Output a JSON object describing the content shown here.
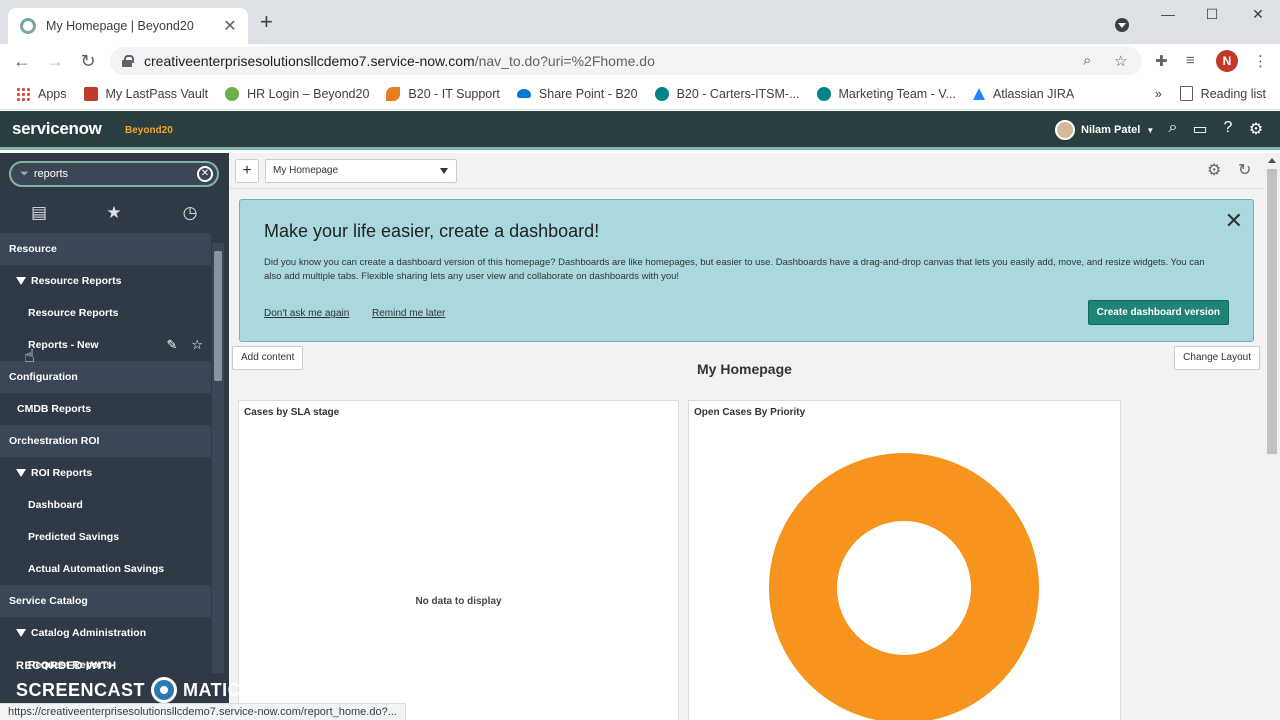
{
  "browser": {
    "tab_title": "My Homepage | Beyond20",
    "url_host": "creativeenterprisesolutionsllcdemo7.service-now.com",
    "url_path": "/nav_to.do?uri=%2Fhome.do",
    "profile_initial": "N",
    "bookmarks": [
      {
        "label": "Apps",
        "color": "#e8453c"
      },
      {
        "label": "My LastPass Vault",
        "color": "#c0392b"
      },
      {
        "label": "HR Login – Beyond20",
        "color": "#6ab04c"
      },
      {
        "label": "B20 - IT Support",
        "color": "#e67e22"
      },
      {
        "label": "Share Point - B20",
        "color": "#0078d4"
      },
      {
        "label": "B20 - Carters-ITSM-...",
        "color": "#038387"
      },
      {
        "label": "Marketing Team - V...",
        "color": "#038387"
      },
      {
        "label": "Atlassian JIRA",
        "color": "#2684ff"
      }
    ],
    "reading_list": "Reading list",
    "more": "»"
  },
  "header": {
    "logo": "servicenow",
    "instance": "Beyond20",
    "user_name": "Nilam Patel"
  },
  "navigator": {
    "filter_value": "reports",
    "items": [
      {
        "type": "app",
        "label": "Resource"
      },
      {
        "type": "sec",
        "label": "Resource Reports"
      },
      {
        "type": "mod",
        "label": "Resource Reports"
      },
      {
        "type": "mod",
        "label": "Reports - New"
      },
      {
        "type": "app",
        "label": "Configuration"
      },
      {
        "type": "mod2",
        "label": "CMDB Reports"
      },
      {
        "type": "app",
        "label": "Orchestration ROI"
      },
      {
        "type": "sec",
        "label": "ROI Reports"
      },
      {
        "type": "mod",
        "label": "Dashboard"
      },
      {
        "type": "mod",
        "label": "Predicted Savings"
      },
      {
        "type": "mod",
        "label": "Actual Automation Savings"
      },
      {
        "type": "app",
        "label": "Service Catalog"
      },
      {
        "type": "sec",
        "label": "Catalog Administration"
      },
      {
        "type": "mod",
        "label": "Request Reports"
      }
    ]
  },
  "content": {
    "homepage_select": "My Homepage",
    "banner": {
      "title": "Make your life easier, create a dashboard!",
      "text": "Did you know you can create a dashboard version of this homepage? Dashboards are like homepages, but easier to use. Dashboards have a drag-and-drop canvas that lets you easily add, move, and resize widgets. You can also add multiple tabs. Flexible sharing lets any user view and collaborate on dashboards with you!",
      "dont_ask": "Don't ask me again",
      "remind": "Remind me later",
      "create_btn": "Create dashboard version"
    },
    "add_content": "Add content",
    "change_layout": "Change Layout",
    "page_title": "My Homepage",
    "widgets": [
      {
        "title": "Cases by SLA stage",
        "empty_text": "No data to display"
      },
      {
        "title": "Open Cases By Priority"
      }
    ]
  },
  "chart_data": {
    "type": "pie",
    "title": "Open Cases By Priority",
    "donut": true,
    "values": [
      1
    ],
    "colors": [
      "#f7941d"
    ]
  },
  "status_bar": "https://creativeenterprisesolutionsllcdemo7.service-now.com/report_home.do?...",
  "watermark": {
    "line1": "RECORDED WITH",
    "line2a": "SCREENCAST",
    "line2b": "MATIC"
  }
}
